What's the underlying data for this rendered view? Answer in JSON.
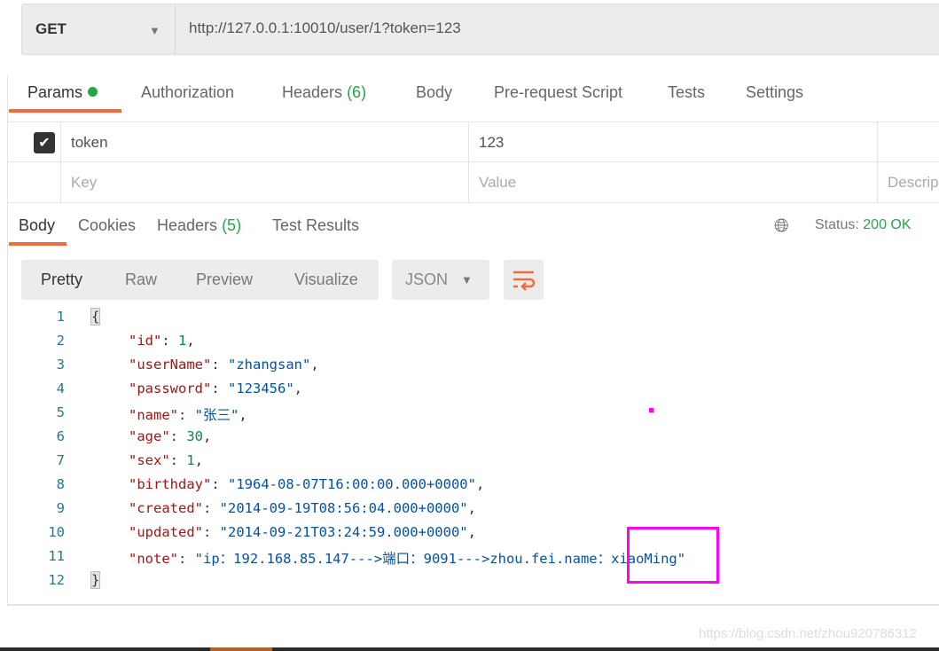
{
  "request": {
    "method": "GET",
    "url": "http://127.0.0.1:10010/user/1?token=123"
  },
  "request_tabs": [
    {
      "label": "Params",
      "active": true,
      "dot": true
    },
    {
      "label": "Authorization"
    },
    {
      "label": "Headers",
      "count": "(6)"
    },
    {
      "label": "Body"
    },
    {
      "label": "Pre-request Script"
    },
    {
      "label": "Tests"
    },
    {
      "label": "Settings"
    }
  ],
  "params": {
    "rows": [
      {
        "checked": true,
        "key": "token",
        "value": "123"
      }
    ],
    "placeholder": {
      "key": "Key",
      "value": "Value",
      "description": "Descrip"
    }
  },
  "response_tabs": [
    {
      "label": "Body",
      "active": true
    },
    {
      "label": "Cookies"
    },
    {
      "label": "Headers",
      "count": "(5)"
    },
    {
      "label": "Test Results"
    }
  ],
  "status": {
    "label": "Status:",
    "value": "200 OK"
  },
  "view_modes": [
    "Pretty",
    "Raw",
    "Preview",
    "Visualize"
  ],
  "format": "JSON",
  "code_lines": [
    {
      "n": "1",
      "t": "{"
    },
    {
      "n": "2",
      "k": "\"id\"",
      "v": "1",
      "type": "n"
    },
    {
      "n": "3",
      "k": "\"userName\"",
      "v": "\"zhangsan\"",
      "type": "s"
    },
    {
      "n": "4",
      "k": "\"password\"",
      "v": "\"123456\"",
      "type": "s"
    },
    {
      "n": "5",
      "k": "\"name\"",
      "v": "\"张三\"",
      "type": "s"
    },
    {
      "n": "6",
      "k": "\"age\"",
      "v": "30",
      "type": "n"
    },
    {
      "n": "7",
      "k": "\"sex\"",
      "v": "1",
      "type": "n"
    },
    {
      "n": "8",
      "k": "\"birthday\"",
      "v": "\"1964-08-07T16:00:00.000+0000\"",
      "type": "s"
    },
    {
      "n": "9",
      "k": "\"created\"",
      "v": "\"2014-09-19T08:56:04.000+0000\"",
      "type": "s"
    },
    {
      "n": "10",
      "k": "\"updated\"",
      "v": "\"2014-09-21T03:24:59.000+0000\"",
      "type": "s"
    },
    {
      "n": "11",
      "k": "\"note\"",
      "v": "\"ip：192.168.85.147--->端口：9091--->zhou.fei.name：xiaoMing\"",
      "type": "s",
      "last": true
    },
    {
      "n": "12",
      "t": "}"
    }
  ],
  "watermark": "https://blog.csdn.net/zhou920786312",
  "colors": {
    "accent": "#f26b3a",
    "highlight_box": "#ff00ff",
    "status_ok": "#26a64a"
  }
}
